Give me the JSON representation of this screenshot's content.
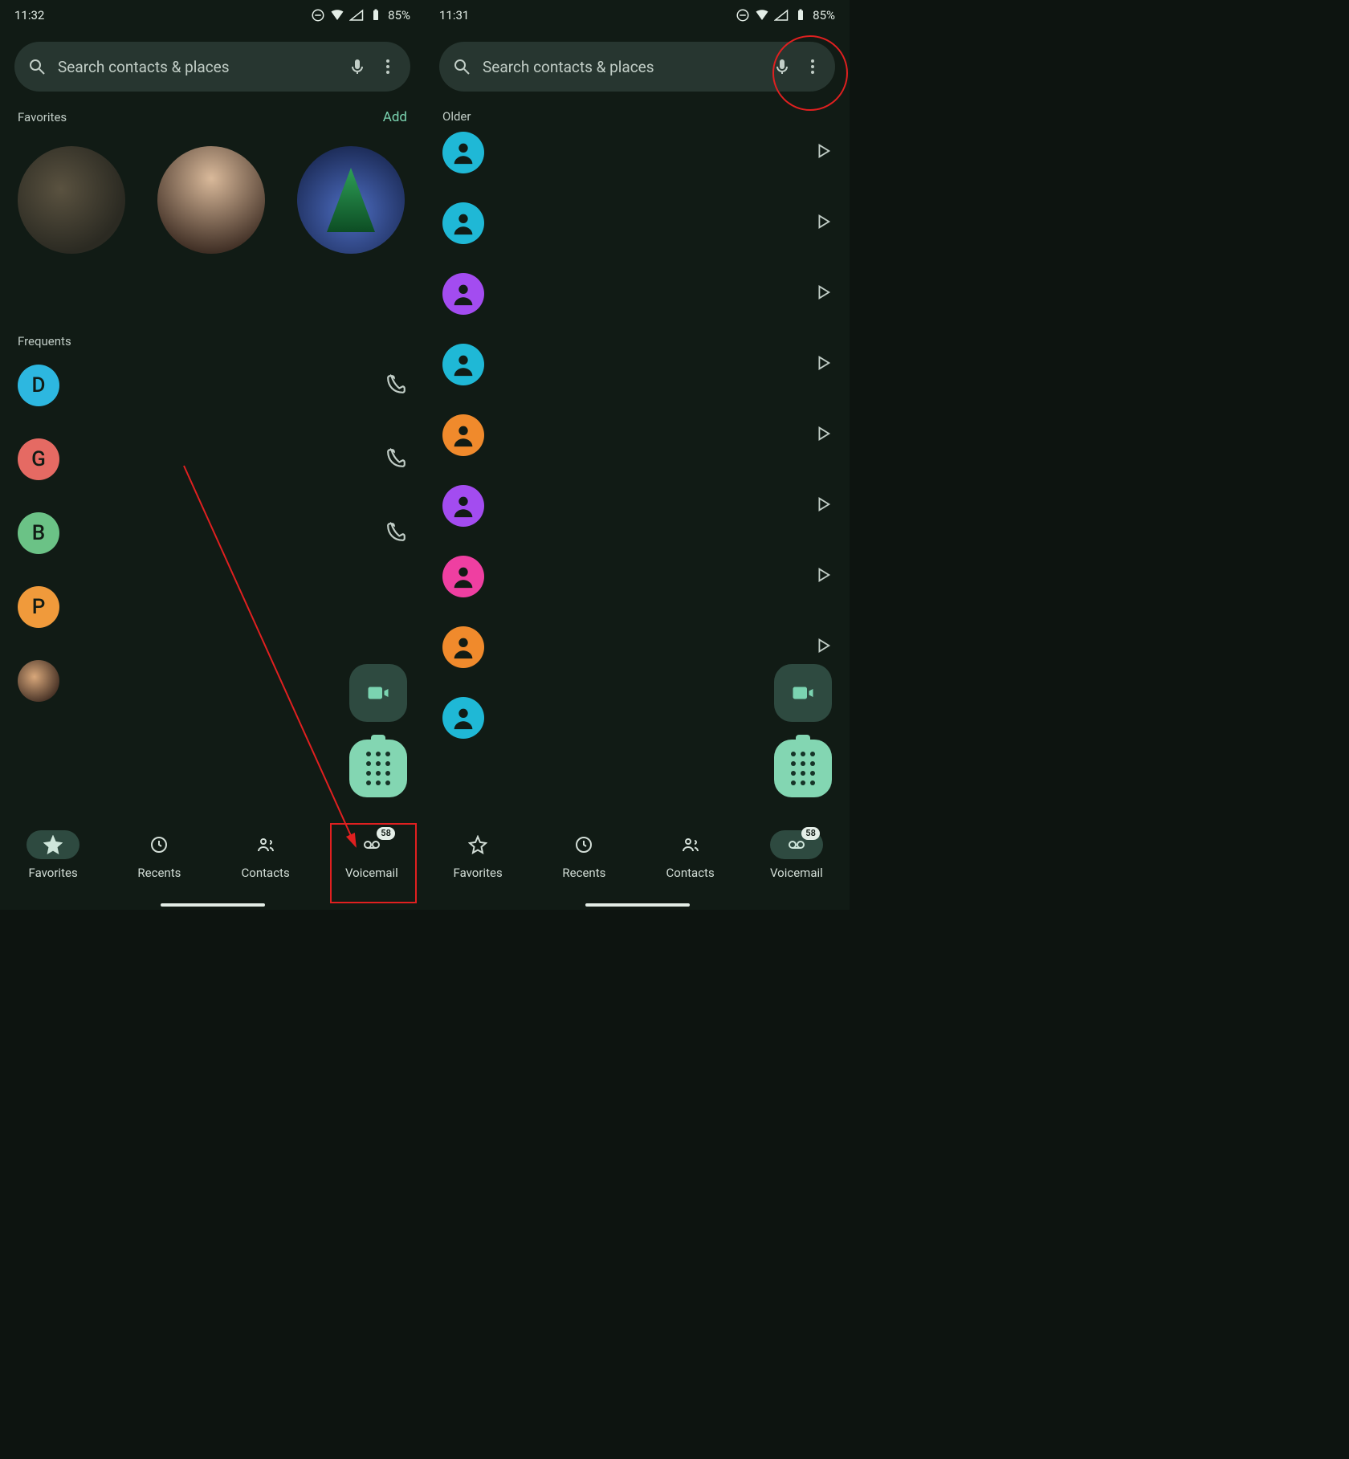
{
  "left": {
    "status": {
      "time": "11:32",
      "battery": "85%"
    },
    "search": {
      "placeholder": "Search contacts & places"
    },
    "favorites_label": "Favorites",
    "add_label": "Add",
    "frequents_label": "Frequents",
    "frequents": [
      {
        "letter": "D",
        "color": "#2db7e0"
      },
      {
        "letter": "G",
        "color": "#e56a63"
      },
      {
        "letter": "B",
        "color": "#6bc286"
      },
      {
        "letter": "P",
        "color": "#f09a3b"
      }
    ],
    "nav": {
      "favorites": "Favorites",
      "recents": "Recents",
      "contacts": "Contacts",
      "voicemail": "Voicemail",
      "voicemail_badge": "58"
    }
  },
  "right": {
    "status": {
      "time": "11:31",
      "battery": "85%"
    },
    "search": {
      "placeholder": "Search contacts & places"
    },
    "older_label": "Older",
    "voicemails": [
      {
        "color": "#1fb8d6"
      },
      {
        "color": "#1fb8d6"
      },
      {
        "color": "#a34cf0"
      },
      {
        "color": "#1fb8d6"
      },
      {
        "color": "#f08a2c"
      },
      {
        "color": "#a34cf0"
      },
      {
        "color": "#ef3fa1"
      },
      {
        "color": "#f08a2c"
      },
      {
        "color": "#1fb8d6"
      }
    ],
    "nav": {
      "favorites": "Favorites",
      "recents": "Recents",
      "contacts": "Contacts",
      "voicemail": "Voicemail",
      "voicemail_badge": "58"
    }
  }
}
